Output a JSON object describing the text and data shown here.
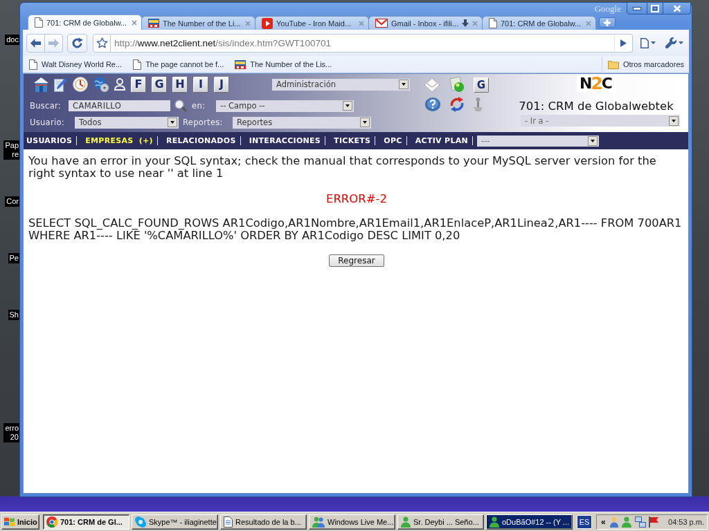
{
  "desktop_icons": [
    {
      "lines": [
        "doc"
      ]
    },
    {
      "lines": [
        "Pap",
        "re"
      ]
    },
    {
      "lines": [
        "Cor"
      ]
    },
    {
      "lines": [
        "Pe"
      ]
    },
    {
      "lines": [
        "Sh"
      ]
    },
    {
      "lines": [
        "erro",
        "20"
      ]
    }
  ],
  "browser": {
    "brand": "Google",
    "tabs": [
      {
        "title": "701: CRM de Globalw...",
        "kind": "page",
        "selected": true,
        "down_arrow": false
      },
      {
        "title": "The Number of the Li...",
        "kind": "picture",
        "selected": false,
        "down_arrow": false
      },
      {
        "title": "YouTube - Iron Maid...",
        "kind": "video",
        "selected": false,
        "down_arrow": false
      },
      {
        "title": "Gmail - Inbox - ifili...",
        "kind": "mail",
        "selected": false,
        "down_arrow": true
      },
      {
        "title": "701: CRM de Globalw...",
        "kind": "page",
        "selected": false,
        "down_arrow": false
      }
    ],
    "nav_buttons": [
      {
        "kind": "back",
        "disabled": false
      },
      {
        "kind": "forward",
        "disabled": true
      },
      {
        "kind": "reload",
        "disabled": false
      }
    ],
    "address": {
      "scheme": "http://",
      "host": "www.net2client.net",
      "path": "/sis/index.htm?GWT100701"
    },
    "bookmarks": [
      {
        "title": "Walt Disney World Re...",
        "kind": "page"
      },
      {
        "title": "The page cannot be f...",
        "kind": "page"
      },
      {
        "title": "The Number of the Lis...",
        "kind": "picture"
      }
    ],
    "other_bookmarks": "Otros marcadores"
  },
  "app": {
    "letter_buttons": [
      "F",
      "G",
      "H",
      "I",
      "J"
    ],
    "module_select": "Administración",
    "search": {
      "label": "Buscar:",
      "value": "CAMARILLO"
    },
    "field_select": {
      "label": "en:",
      "value": "-- Campo --"
    },
    "user_select": {
      "label": "Usuario:",
      "value": "Todos"
    },
    "reports_select": {
      "label": "Reportes:",
      "value": "Reportes"
    },
    "g_button": "G",
    "logo": [
      "N",
      "2",
      "C"
    ],
    "title": "701: CRM de Globalwebtek",
    "goto_select": "- Ir a -",
    "menu": [
      {
        "label": "USUARIOS",
        "selected": false
      },
      {
        "label": "EMPRESAS  (+)",
        "selected": true
      },
      {
        "label": "RELACIONADOS",
        "selected": false
      },
      {
        "label": "INTERACCIONES",
        "selected": false
      },
      {
        "label": "TICKETS",
        "selected": false
      },
      {
        "label": "OPC",
        "selected": false
      },
      {
        "label": "ACTIV PLAN",
        "selected": false
      }
    ],
    "menu_select": "---"
  },
  "result": {
    "message": "You have an error in your SQL syntax; check the manual that corresponds to your MySQL server version for the right syntax to use near '' at line 1",
    "error_code": "ERROR#-2",
    "query": "SELECT SQL_CALC_FOUND_ROWS AR1Codigo,AR1Nombre,AR1Email1,AR1EnlaceP,AR1Linea2,AR1---- FROM 700AR1 WHERE AR1---- LIKE '%CAMARILLO%' ORDER BY AR1Codigo DESC LIMIT 0,20",
    "back_button": "Regresar"
  },
  "taskbar": {
    "start": "Inicio",
    "tasks": [
      {
        "label": "701: CRM de Gl...",
        "kind": "browser",
        "selected": true,
        "flashing": false
      },
      {
        "label": "Skype™ - iliaginette",
        "kind": "chat",
        "selected": false,
        "flashing": false
      },
      {
        "label": "Resultado de la b...",
        "kind": "document",
        "selected": false,
        "flashing": false
      },
      {
        "label": "Windows Live Me...",
        "kind": "contacts",
        "selected": false,
        "flashing": false
      },
      {
        "label": "Sr. Deybi ... Seño...",
        "kind": "contact",
        "selected": false,
        "flashing": false
      },
      {
        "label": "oDuBãO#12 -- (Y ...",
        "kind": "contact",
        "selected": false,
        "flashing": true
      }
    ],
    "language": "ES",
    "tray_toggle": "«",
    "clock": "04:53 p.m."
  }
}
